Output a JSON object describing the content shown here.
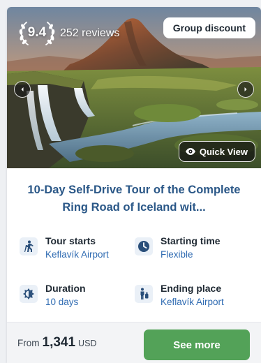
{
  "card": {
    "rating": {
      "score": "9.4",
      "reviews": "252 reviews"
    },
    "badge": "Group discount",
    "quick_view": "Quick View",
    "title": "10-Day Self-Drive Tour of the Complete Ring Road of Iceland wit...",
    "facts": [
      {
        "label": "Tour starts",
        "value": "Keflavík Airport",
        "icon": "hiker-icon"
      },
      {
        "label": "Starting time",
        "value": "Flexible",
        "icon": "clock-icon"
      },
      {
        "label": "Duration",
        "value": "10 days",
        "icon": "day-night-icon"
      },
      {
        "label": "Ending place",
        "value": "Keflavík Airport",
        "icon": "person-luggage-icon"
      }
    ],
    "price": {
      "from": "From",
      "amount": "1,341",
      "currency": "USD"
    },
    "cta": "See more"
  },
  "colors": {
    "title": "#2a5787",
    "link_value": "#2f6bb2",
    "cta_green": "#53a258",
    "icon_bg": "#eaf0f7",
    "icon_fg": "#2a4f7a"
  }
}
